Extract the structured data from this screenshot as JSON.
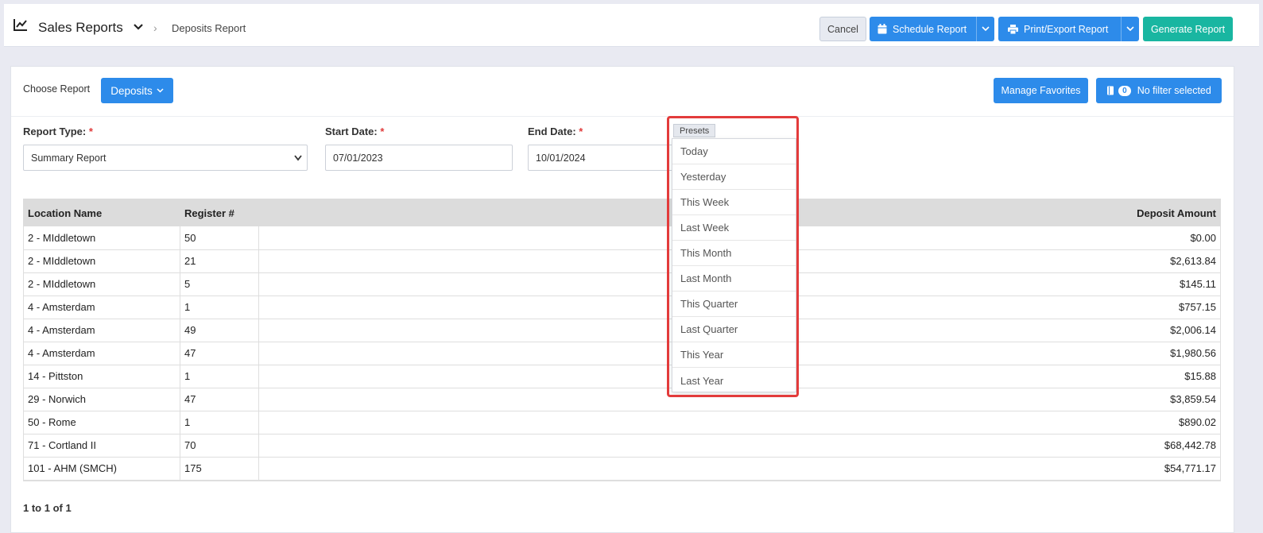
{
  "header": {
    "app_title": "Sales Reports",
    "breadcrumb": "Deposits Report",
    "cancel_label": "Cancel",
    "schedule_label": "Schedule Report",
    "print_label": "Print/Export Report",
    "generate_label": "Generate Report"
  },
  "toolbar": {
    "choose_report_label": "Choose Report",
    "report_dropdown_label": "Deposits",
    "manage_favorites_label": "Manage Favorites",
    "filter_count": "0",
    "filter_label": "No filter selected"
  },
  "form": {
    "report_type_label": "Report Type:",
    "report_type_value": "Summary Report",
    "start_date_label": "Start Date:",
    "start_date_value": "07/01/2023",
    "end_date_label": "End Date:",
    "end_date_value": "10/01/2024",
    "required_marker": "*"
  },
  "presets": {
    "tag_label": "Presets",
    "items": [
      "Today",
      "Yesterday",
      "This Week",
      "Last Week",
      "This Month",
      "Last Month",
      "This Quarter",
      "Last Quarter",
      "This Year",
      "Last Year"
    ]
  },
  "table": {
    "columns": [
      "Location Name",
      "Register #",
      "Deposit Amount"
    ],
    "rows": [
      [
        "2 - MIddletown",
        "50",
        "$0.00"
      ],
      [
        "2 - MIddletown",
        "21",
        "$2,613.84"
      ],
      [
        "2 - MIddletown",
        "5",
        "$145.11"
      ],
      [
        "4 - Amsterdam",
        "1",
        "$757.15"
      ],
      [
        "4 - Amsterdam",
        "49",
        "$2,006.14"
      ],
      [
        "4 - Amsterdam",
        "47",
        "$1,980.56"
      ],
      [
        "14 - Pittston",
        "1",
        "$15.88"
      ],
      [
        "29 - Norwich",
        "47",
        "$3,859.54"
      ],
      [
        "50 - Rome",
        "1",
        "$890.02"
      ],
      [
        "71 - Cortland II",
        "70",
        "$68,442.78"
      ],
      [
        "101 - AHM (SMCH)",
        "175",
        "$54,771.17"
      ]
    ],
    "pagination": "1 to 1 of 1"
  },
  "colors": {
    "primary": "#2d8bea",
    "accent": "#19b6a1",
    "highlight": "#e33b3b"
  }
}
